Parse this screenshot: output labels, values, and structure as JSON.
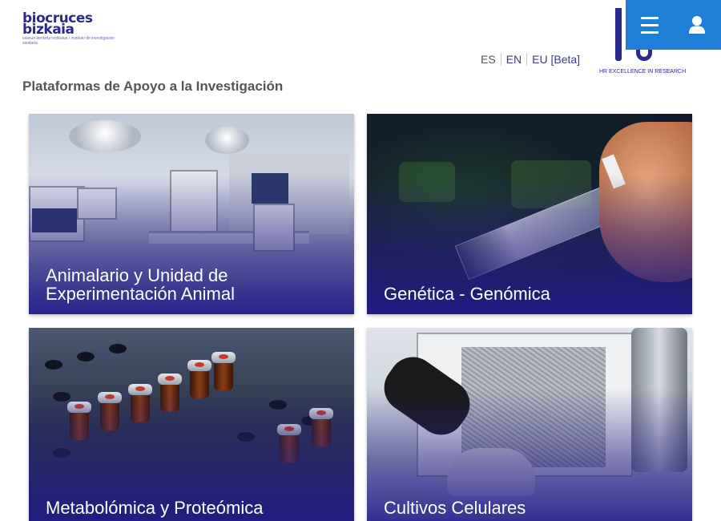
{
  "header": {
    "logo": {
      "line1": "biocruces",
      "line2": "bizkaia",
      "tagline": "osasun ikerketa institutua / instituto de investigación sanitaria"
    },
    "languages": [
      {
        "code": "ES"
      },
      {
        "code": "EN"
      },
      {
        "code": "EU [Beta]"
      }
    ],
    "hr_badge": {
      "text": "HR EXCELLENCE IN RESEARCH"
    },
    "actions": {
      "menu_icon": "hamburger-menu-icon",
      "user_icon": "user-icon"
    },
    "colors": {
      "action_bar": "#1f7fd6",
      "brand": "#2b2a8a"
    }
  },
  "main": {
    "section_title": "Plataformas de Apoyo a la Investigación",
    "cards": [
      {
        "title": "Animalario y Unidad de Experimentación Animal"
      },
      {
        "title": "Genética - Genómica"
      },
      {
        "title": "Metabolómica y Proteómica"
      },
      {
        "title": "Cultivos Celulares"
      }
    ]
  }
}
